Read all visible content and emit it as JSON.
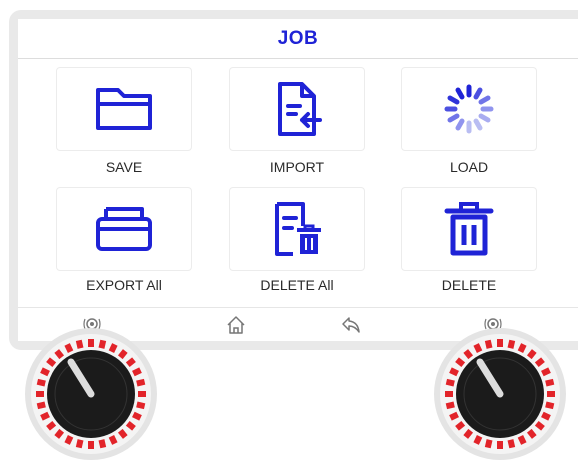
{
  "header": {
    "title": "JOB"
  },
  "actions": [
    {
      "label": "SAVE",
      "icon": "folder-icon"
    },
    {
      "label": "IMPORT",
      "icon": "file-import-icon"
    },
    {
      "label": "LOAD",
      "icon": "loading-spinner-icon"
    },
    {
      "label": "EXPORT All",
      "icon": "tray-export-icon"
    },
    {
      "label": "DELETE All",
      "icon": "file-delete-icon"
    },
    {
      "label": "DELETE",
      "icon": "trash-icon"
    }
  ],
  "bottom_bar": {
    "icons": [
      "left-knob-icon",
      "home-icon",
      "back-icon",
      "right-knob-icon"
    ]
  },
  "colors": {
    "accent": "#1f23d6",
    "spinner_light": "#b9bdf2",
    "knob_ring": "#e2242a",
    "knob_body": "#1b1b1b",
    "frame": "#e9e9e9"
  }
}
